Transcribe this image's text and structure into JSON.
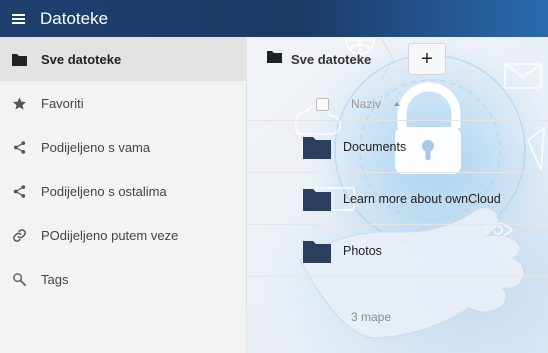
{
  "header": {
    "title": "Datoteke",
    "menu_icon": "hamburger-icon"
  },
  "sidebar": {
    "items": [
      {
        "label": "Sve datoteke",
        "icon": "folder-icon",
        "active": true
      },
      {
        "label": "Favoriti",
        "icon": "star-icon",
        "active": false
      },
      {
        "label": "Podijeljeno s vama",
        "icon": "share-icon",
        "active": false
      },
      {
        "label": "Podijeljeno s ostalima",
        "icon": "share-icon",
        "active": false
      },
      {
        "label": "POdijeljeno putem veze",
        "icon": "link-icon",
        "active": false
      },
      {
        "label": "Tags",
        "icon": "search-icon",
        "active": false
      }
    ]
  },
  "breadcrumb": {
    "label": "Sve datoteke",
    "icon": "folder-icon"
  },
  "toolbar": {
    "add_label": "+"
  },
  "table": {
    "column_name": "Naziv",
    "rows": [
      {
        "name": "Documents",
        "icon": "folder-icon"
      },
      {
        "name": "Learn more about ownCloud",
        "icon": "folder-icon"
      },
      {
        "name": "Photos",
        "icon": "folder-icon"
      }
    ],
    "summary": "3 mape"
  },
  "colors": {
    "header": "#1f3f6e",
    "folder": "#2c3e5e",
    "accent": "#2b6ab0"
  }
}
